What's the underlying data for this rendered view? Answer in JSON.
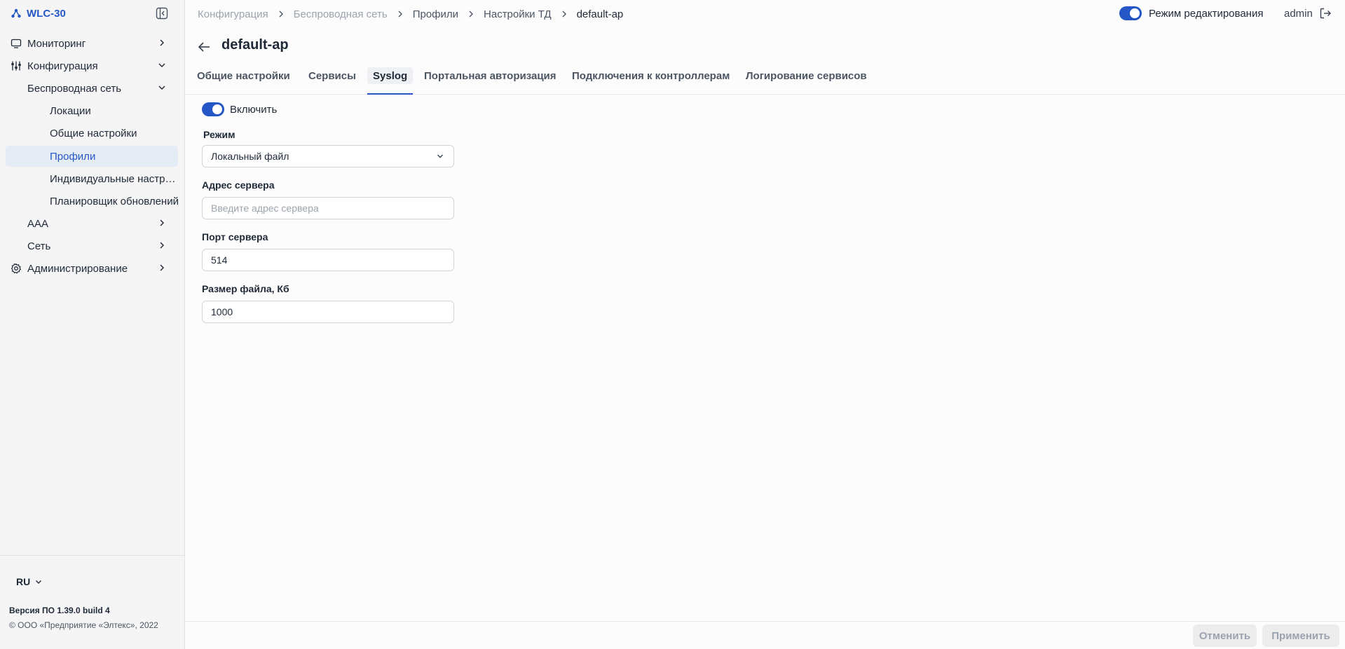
{
  "app": {
    "name": "WLC-30"
  },
  "sidebar": {
    "items": [
      {
        "label": "Мониторинг"
      },
      {
        "label": "Конфигурация"
      },
      {
        "label": "Беспроводная сеть"
      },
      {
        "label": "Локации"
      },
      {
        "label": "Общие настройки"
      },
      {
        "label": "Профили"
      },
      {
        "label": "Индивидуальные настройки"
      },
      {
        "label": "Планировщик обновлений"
      },
      {
        "label": "AAA"
      },
      {
        "label": "Сеть"
      },
      {
        "label": "Администрирование"
      }
    ],
    "language": "RU",
    "version": "Версия ПО 1.39.0 build 4",
    "copyright": "© ООО «Предприятие «Элтекс», 2022"
  },
  "header": {
    "breadcrumb": [
      "Конфигурация",
      "Беспроводная сеть",
      "Профили",
      "Настройки ТД",
      "default-ap"
    ],
    "edit_mode_label": "Режим редактирования",
    "edit_mode_on": true,
    "user": "admin"
  },
  "page": {
    "title": "default-ap"
  },
  "tabs": [
    {
      "label": "Общие настройки"
    },
    {
      "label": "Сервисы"
    },
    {
      "label": "Syslog",
      "active": true
    },
    {
      "label": "Портальная авторизация"
    },
    {
      "label": "Подключения к контроллерам"
    },
    {
      "label": "Логирование сервисов"
    }
  ],
  "form": {
    "enable_label": "Включить",
    "enabled": true,
    "mode_label": "Режим",
    "mode_value": "Локальный файл",
    "server_address_label": "Адрес сервера",
    "server_address_value": "",
    "server_address_placeholder": "Введите адрес сервера",
    "server_port_label": "Порт сервера",
    "server_port_value": "514",
    "file_size_label": "Размер файла, Кб",
    "file_size_value": "1000"
  },
  "footer": {
    "cancel_label": "Отменить",
    "apply_label": "Применить"
  },
  "colors": {
    "accent": "#2457c5",
    "sidebar_bg": "#f5f5f5",
    "active_item_bg": "#e6ecf6"
  }
}
